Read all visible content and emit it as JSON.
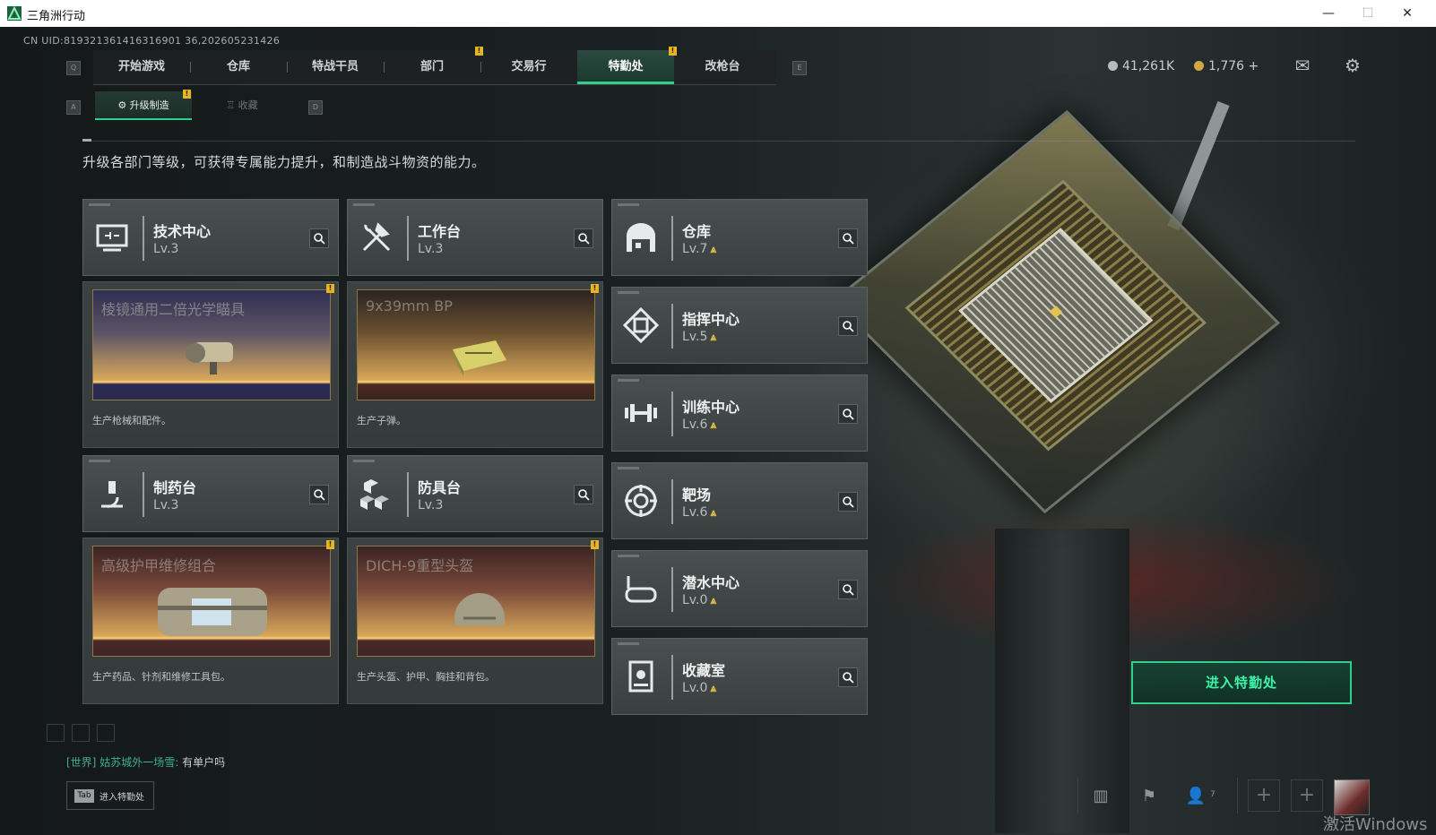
{
  "window": {
    "title": "三角洲行动",
    "controls": {
      "minimize": "—",
      "maximize": "☐",
      "close": "✕"
    }
  },
  "uid": "CN UID:819321361416316901 36,202605231426",
  "keys": {
    "nav_left": "Q",
    "nav_right": "E",
    "sub_left": "A",
    "sub_right": "D",
    "tab": "Tab"
  },
  "nav": {
    "tabs": [
      {
        "label": "开始游戏"
      },
      {
        "label": "仓库"
      },
      {
        "label": "特战干员"
      },
      {
        "label": "部门"
      },
      {
        "label": "交易行"
      },
      {
        "label": "特勤处",
        "active": true
      },
      {
        "label": "改枪台"
      }
    ],
    "badge": "!"
  },
  "subnav": {
    "tabs": [
      {
        "label": "升级制造",
        "active": true
      },
      {
        "label": "收藏"
      }
    ]
  },
  "currency": {
    "silver": "41,261K",
    "gold": "1,776",
    "gold_plus": "+"
  },
  "description": "升级各部门等级，可获得专属能力提升，和制造战斗物资的能力。",
  "facilities": [
    {
      "name": "技术中心",
      "level": "Lv.3",
      "icon": "monitor-icon"
    },
    {
      "name": "工作台",
      "level": "Lv.3",
      "icon": "tools-icon"
    },
    {
      "name": "仓库",
      "level": "Lv.7",
      "icon": "warehouse-icon",
      "upgradable": true
    },
    {
      "name": "指挥中心",
      "level": "Lv.5",
      "icon": "command-icon",
      "upgradable": true
    },
    {
      "name": "训练中心",
      "level": "Lv.6",
      "icon": "dumbbell-icon",
      "upgradable": true
    },
    {
      "name": "制药台",
      "level": "Lv.3",
      "icon": "microscope-icon"
    },
    {
      "name": "防具台",
      "level": "Lv.3",
      "icon": "boxes-icon"
    },
    {
      "name": "靶场",
      "level": "Lv.6",
      "icon": "target-icon",
      "upgradable": true
    },
    {
      "name": "潜水中心",
      "level": "Lv.0",
      "icon": "diving-mask-icon",
      "upgradable": true
    },
    {
      "name": "收藏室",
      "level": "Lv.0",
      "icon": "trophy-case-icon",
      "upgradable": true
    }
  ],
  "upgrade_glyph": "⩓",
  "production": [
    {
      "item": "棱镜通用二倍光学瞄具",
      "caption": "生产枪械和配件。",
      "tone": "blue"
    },
    {
      "item": "9x39mm BP",
      "caption": "生产子弹。",
      "tone": "gold"
    },
    {
      "item": "高级护甲维修组合",
      "caption": "生产药品、针剂和维修工具包。",
      "tone": "rose"
    },
    {
      "item": "DICH-9重型头盔",
      "caption": "生产头盔、护甲、胸挂和背包。",
      "tone": "rose"
    }
  ],
  "enter_button": "进入特勤处",
  "tab_hint": "进入特勤处",
  "chat": {
    "channel": "[世界]",
    "user": "姑苏城外一场雪:",
    "message": "有单户吗"
  },
  "bottom": {
    "friends_count": "7",
    "plus": "+"
  },
  "watermark": "激活Windows",
  "colors": {
    "accent": "#2fcf8c",
    "badge": "#e7b422",
    "upgrade": "#e8c548"
  }
}
